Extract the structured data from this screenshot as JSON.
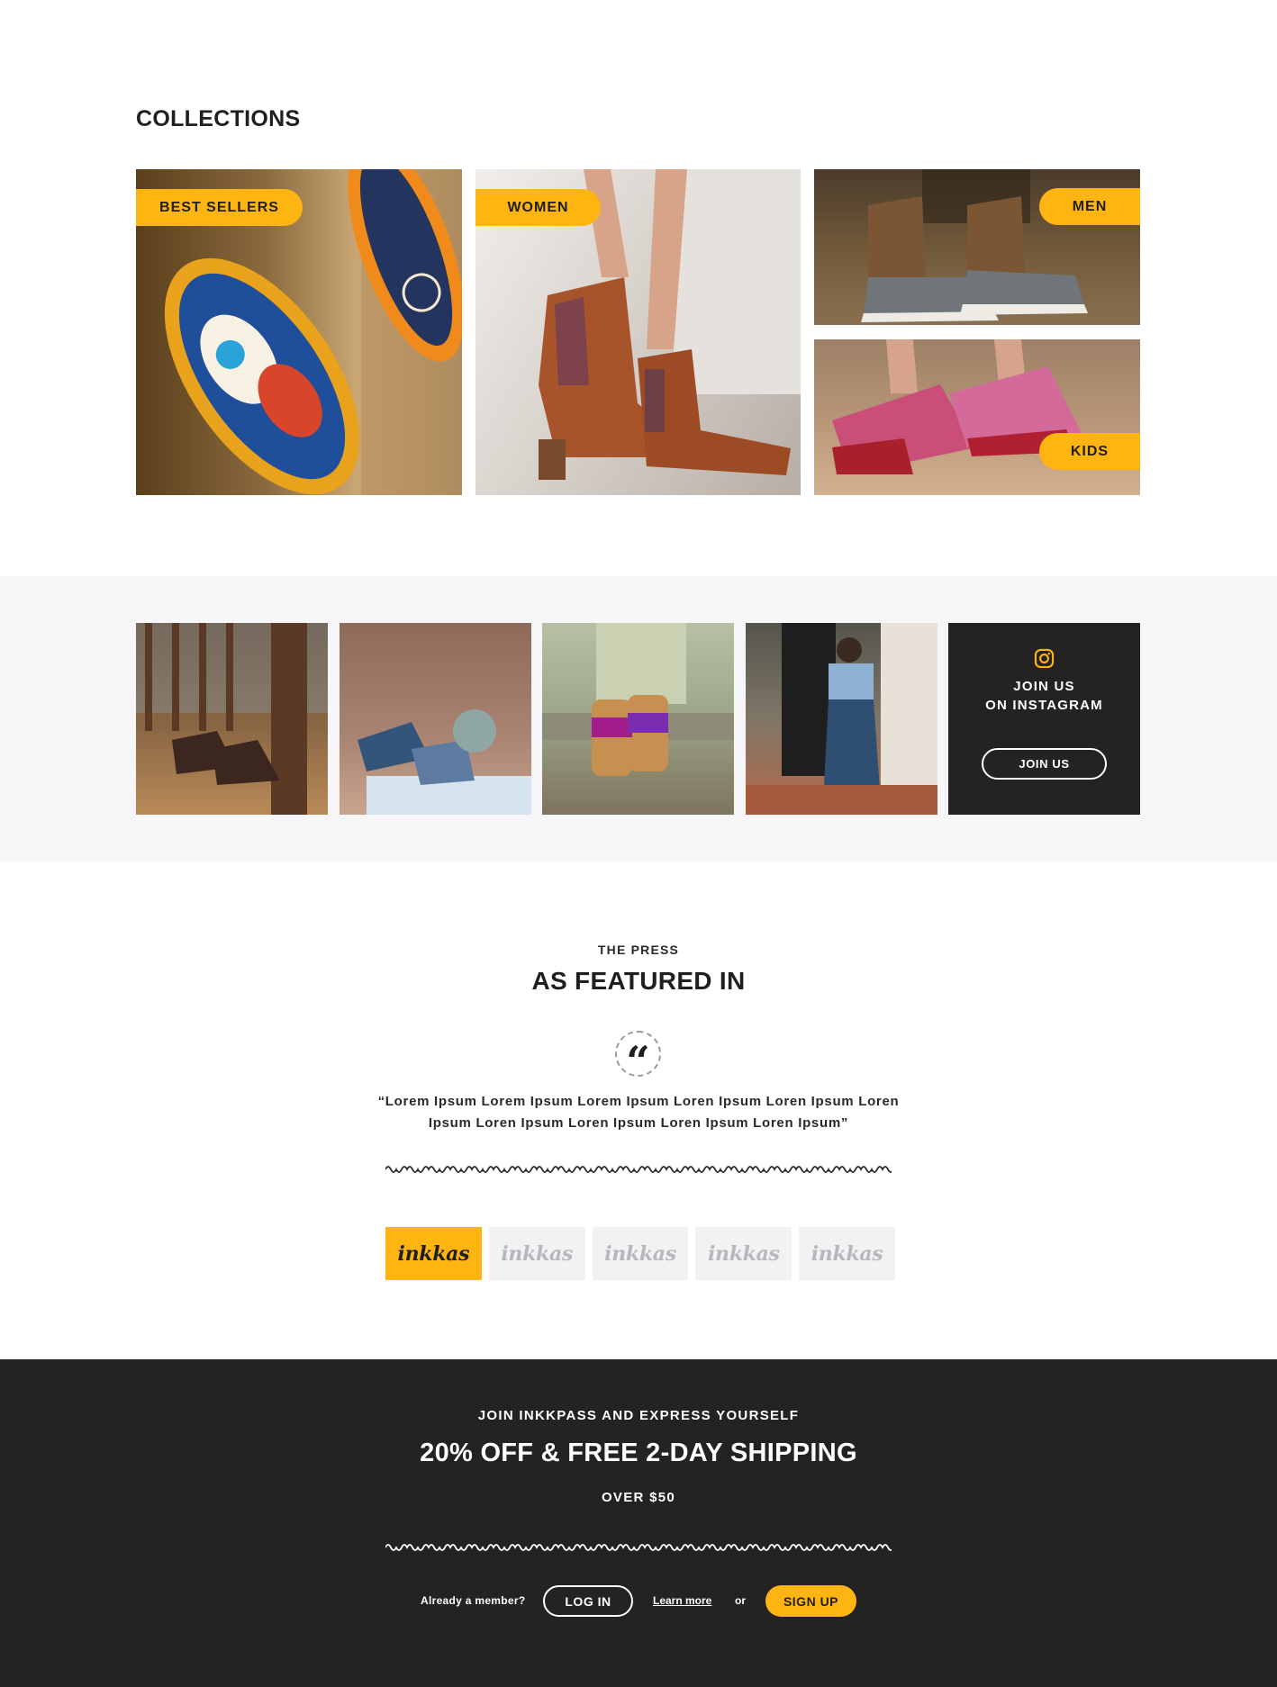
{
  "collections": {
    "title": "COLLECTIONS",
    "tiles": [
      {
        "label": "BEST SELLERS",
        "image": "patterned-slip-on-shoes-photo"
      },
      {
        "label": "WOMEN",
        "image": "brown-leather-ankle-boots-photo"
      },
      {
        "label": "MEN",
        "image": "patterned-high-top-sneakers-photo"
      },
      {
        "label": "KIDS",
        "image": "pink-red-sneakers-photo"
      }
    ]
  },
  "instagram": {
    "photos": [
      "boots-on-porch-photo",
      "woman-lying-on-ground-photo",
      "sandals-on-steps-photo",
      "woman-standing-doorway-photo"
    ],
    "icon": "instagram-icon",
    "heading_line1": "JOIN US",
    "heading_line2": "ON INSTAGRAM",
    "button_label": "JOIN US"
  },
  "press": {
    "eyebrow": "THE PRESS",
    "title": "AS FEATURED IN",
    "quote_icon": "quote-icon",
    "quote": "“Lorem Ipsum Lorem Ipsum Lorem Ipsum Loren Ipsum Loren Ipsum Loren Ipsum Loren Ipsum Loren Ipsum Loren Ipsum Loren Ipsum”",
    "logos": [
      {
        "text": "inkkas",
        "active": true
      },
      {
        "text": "inkkas",
        "active": false
      },
      {
        "text": "inkkas",
        "active": false
      },
      {
        "text": "inkkas",
        "active": false
      },
      {
        "text": "inkkas",
        "active": false
      }
    ]
  },
  "promo": {
    "eyebrow": "JOIN INKKPASS AND EXPRESS YOURSELF",
    "title": "20% OFF & FREE 2-DAY SHIPPING",
    "subtitle": "OVER $50",
    "member_text": "Already a member?",
    "login_label": "LOG IN",
    "learn_more": "Learn more",
    "or_text": "or",
    "signup_label": "SIGN UP"
  },
  "colors": {
    "accent": "#ffb511",
    "dark": "#242223",
    "band": "#f6f6f8",
    "logo_tile": "#f2f2f4"
  }
}
